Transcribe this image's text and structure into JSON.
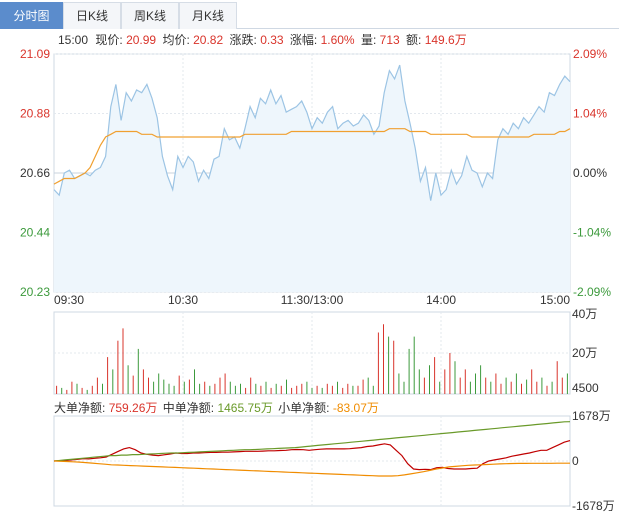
{
  "tabs": [
    {
      "label": "分时图",
      "active": true
    },
    {
      "label": "日K线",
      "active": false
    },
    {
      "label": "周K线",
      "active": false
    },
    {
      "label": "月K线",
      "active": false
    }
  ],
  "quote": {
    "time": "15:00",
    "price_label": "现价:",
    "price": "20.99",
    "avg_label": "均价:",
    "avg": "20.82",
    "change_label": "涨跌:",
    "change": "0.33",
    "pct_label": "涨幅:",
    "pct": "1.60%",
    "vol_label": "量:",
    "vol": "713",
    "amount_label": "额:",
    "amount": "149.6万"
  },
  "flow": {
    "large_label": "大单净额:",
    "large": "759.26万",
    "medium_label": "中单净额:",
    "medium": "1465.75万",
    "small_label": "小单净额:",
    "small": "-83.07万"
  },
  "colors": {
    "up": "#d9342b",
    "down": "#3c9a3c",
    "neutral": "#333333",
    "price_line": "#9cc4e4",
    "price_fill": "#eef6fc",
    "avg_line": "#f0a030",
    "large_line": "#c00000",
    "medium_line": "#6a9a2a",
    "small_line": "#f08c00",
    "grid": "#e3e8ee"
  },
  "chart_data": [
    {
      "type": "line",
      "name": "intraday-price",
      "y_left_ticks": [
        "21.09",
        "20.88",
        "20.66",
        "20.44",
        "20.23"
      ],
      "y_right_ticks": [
        "2.09%",
        "1.04%",
        "0.00%",
        "-1.04%",
        "-2.09%"
      ],
      "x_ticks": [
        "09:30",
        "10:30",
        "11:30/13:00",
        "14:00",
        "15:00"
      ],
      "ylim": [
        20.23,
        21.09
      ],
      "prev_close": 20.66,
      "price": [
        20.6,
        20.58,
        20.66,
        20.67,
        20.64,
        20.65,
        20.66,
        20.65,
        20.67,
        20.68,
        20.72,
        20.9,
        20.98,
        20.85,
        20.95,
        20.92,
        20.96,
        20.95,
        20.98,
        20.93,
        20.86,
        20.72,
        20.65,
        20.6,
        20.72,
        20.68,
        20.72,
        20.7,
        20.63,
        20.67,
        20.64,
        20.71,
        20.72,
        20.82,
        20.78,
        20.79,
        20.75,
        20.82,
        20.9,
        20.86,
        20.93,
        20.91,
        20.96,
        20.91,
        20.94,
        20.88,
        20.89,
        20.9,
        20.92,
        20.88,
        20.82,
        20.86,
        20.84,
        20.88,
        20.9,
        20.82,
        20.84,
        20.85,
        20.83,
        20.84,
        20.87,
        20.85,
        20.8,
        20.83,
        20.95,
        21.03,
        21.0,
        21.05,
        20.92,
        20.84,
        20.75,
        20.63,
        20.68,
        20.56,
        20.66,
        20.58,
        20.6,
        20.67,
        20.62,
        20.65,
        20.72,
        20.67,
        20.66,
        20.61,
        20.66,
        20.64,
        20.78,
        20.82,
        20.8,
        20.84,
        20.82,
        20.86,
        20.84,
        20.87,
        20.9,
        20.88,
        20.95,
        20.94,
        20.98,
        21.01,
        20.99
      ],
      "avg": [
        20.62,
        20.63,
        20.64,
        20.64,
        20.64,
        20.65,
        20.66,
        20.68,
        20.72,
        20.76,
        20.79,
        20.8,
        20.81,
        20.81,
        20.81,
        20.81,
        20.81,
        20.8,
        20.8,
        20.8,
        20.79,
        20.79,
        20.79,
        20.79,
        20.79,
        20.79,
        20.79,
        20.79,
        20.79,
        20.79,
        20.79,
        20.79,
        20.79,
        20.79,
        20.79,
        20.79,
        20.79,
        20.8,
        20.8,
        20.8,
        20.8,
        20.8,
        20.8,
        20.8,
        20.8,
        20.8,
        20.81,
        20.81,
        20.81,
        20.81,
        20.81,
        20.81,
        20.81,
        20.81,
        20.81,
        20.81,
        20.81,
        20.81,
        20.81,
        20.81,
        20.81,
        20.81,
        20.81,
        20.81,
        20.81,
        20.82,
        20.82,
        20.82,
        20.82,
        20.81,
        20.81,
        20.81,
        20.81,
        20.8,
        20.8,
        20.8,
        20.8,
        20.8,
        20.8,
        20.8,
        20.8,
        20.79,
        20.79,
        20.79,
        20.79,
        20.79,
        20.79,
        20.79,
        20.79,
        20.79,
        20.79,
        20.79,
        20.79,
        20.8,
        20.8,
        20.8,
        20.8,
        20.8,
        20.81,
        20.81,
        20.82
      ]
    },
    {
      "type": "bar",
      "name": "volume",
      "y_ticks": [
        "40万",
        "20万",
        "4500"
      ],
      "ylim": [
        0,
        40
      ],
      "values": [
        4,
        3,
        2,
        6,
        5,
        3,
        2,
        4,
        8,
        5,
        18,
        12,
        26,
        32,
        14,
        9,
        22,
        12,
        8,
        6,
        10,
        7,
        5,
        4,
        9,
        6,
        7,
        12,
        5,
        6,
        4,
        5,
        8,
        10,
        6,
        4,
        5,
        3,
        8,
        5,
        4,
        6,
        3,
        5,
        4,
        7,
        3,
        4,
        5,
        6,
        3,
        4,
        3,
        5,
        4,
        6,
        3,
        5,
        4,
        4,
        7,
        8,
        4,
        30,
        34,
        28,
        26,
        10,
        6,
        22,
        28,
        12,
        8,
        14,
        18,
        6,
        12,
        20,
        16,
        8,
        12,
        6,
        10,
        14,
        8,
        6,
        10,
        5,
        8,
        6,
        10,
        5,
        7,
        12,
        6,
        8,
        4,
        6,
        16,
        8,
        10
      ],
      "up": [
        1,
        0,
        1,
        1,
        0,
        1,
        0,
        1,
        1,
        0,
        1,
        0,
        1,
        1,
        0,
        1,
        0,
        1,
        1,
        0,
        0,
        0,
        0,
        0,
        1,
        0,
        1,
        0,
        0,
        1,
        0,
        1,
        1,
        1,
        0,
        0,
        0,
        1,
        1,
        0,
        1,
        0,
        1,
        0,
        1,
        0,
        1,
        1,
        1,
        0,
        0,
        1,
        0,
        1,
        1,
        0,
        1,
        1,
        0,
        1,
        1,
        0,
        0,
        1,
        1,
        0,
        1,
        0,
        0,
        0,
        0,
        0,
        1,
        0,
        1,
        0,
        1,
        1,
        0,
        1,
        1,
        0,
        0,
        0,
        1,
        0,
        1,
        1,
        0,
        1,
        0,
        1,
        0,
        1,
        1,
        0,
        1,
        0,
        1,
        1,
        0
      ]
    },
    {
      "type": "line",
      "name": "net-flow",
      "y_ticks": [
        "1678万",
        "0",
        "-1678万"
      ],
      "ylim": [
        -1678,
        1678
      ],
      "series": [
        {
          "name": "大单净额",
          "values": [
            0,
            10,
            20,
            40,
            60,
            90,
            80,
            100,
            120,
            150,
            250,
            350,
            450,
            500,
            420,
            300,
            250,
            220,
            200,
            230,
            260,
            300,
            280,
            280,
            300,
            300,
            310,
            320,
            320,
            330,
            330,
            340,
            350,
            360,
            360,
            360,
            370,
            380,
            380,
            390,
            400,
            420,
            430,
            420,
            400,
            420,
            440,
            450,
            450,
            450,
            450,
            460,
            480,
            500,
            540,
            560,
            600,
            640,
            600,
            400,
            200,
            -100,
            -300,
            -320,
            -310,
            -320,
            -250,
            -240,
            -280,
            -300,
            -300,
            -300,
            -280,
            -270,
            -100,
            0,
            40,
            80,
            120,
            180,
            220,
            260,
            300,
            350,
            400,
            400,
            500,
            600,
            700,
            760
          ]
        },
        {
          "name": "中单净额",
          "values": [
            0,
            20,
            40,
            60,
            80,
            100,
            120,
            140,
            160,
            180,
            200,
            200,
            220,
            220,
            240,
            240,
            250,
            260,
            270,
            280,
            290,
            300,
            300,
            310,
            320,
            330,
            340,
            350,
            360,
            370,
            380,
            390,
            400,
            410,
            420,
            420,
            430,
            440,
            450,
            460,
            470,
            480,
            490,
            500,
            520,
            540,
            560,
            580,
            600,
            620,
            640,
            660,
            680,
            700,
            720,
            740,
            760,
            780,
            800,
            820,
            840,
            860,
            880,
            900,
            920,
            940,
            960,
            980,
            1000,
            1020,
            1040,
            1060,
            1080,
            1100,
            1120,
            1140,
            1160,
            1180,
            1200,
            1220,
            1240,
            1260,
            1280,
            1300,
            1320,
            1340,
            1360,
            1380,
            1400,
            1420,
            1440,
            1460,
            1466
          ]
        },
        {
          "name": "小单净额",
          "values": [
            0,
            -10,
            -20,
            -30,
            -40,
            -60,
            -80,
            -100,
            -120,
            -140,
            -150,
            -160,
            -170,
            -180,
            -190,
            -200,
            -210,
            -220,
            -230,
            -240,
            -250,
            -260,
            -270,
            -280,
            -290,
            -300,
            -310,
            -320,
            -330,
            -340,
            -350,
            -360,
            -370,
            -380,
            -390,
            -400,
            -410,
            -420,
            -430,
            -440,
            -450,
            -460,
            -470,
            -480,
            -490,
            -500,
            -510,
            -520,
            -530,
            -540,
            -550,
            -560,
            -560,
            -560,
            -550,
            -520,
            -480,
            -440,
            -400,
            -350,
            -300,
            -260,
            -220,
            -200,
            -180,
            -160,
            -150,
            -140,
            -130,
            -120,
            -110,
            -100,
            -95,
            -90,
            -88,
            -86,
            -85,
            -84,
            -84,
            -83,
            -83,
            -83
          ]
        }
      ]
    }
  ]
}
